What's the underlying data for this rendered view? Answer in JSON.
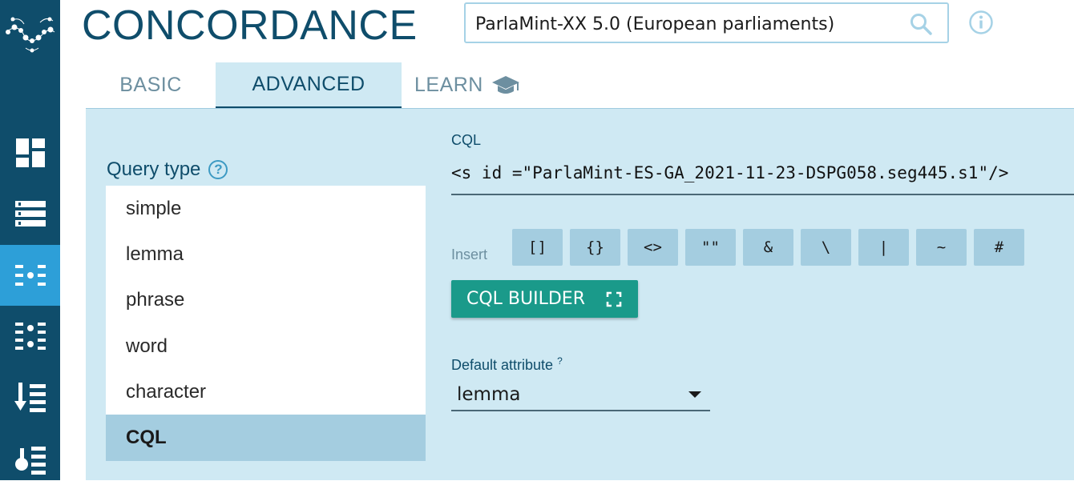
{
  "app": {
    "title": "CONCORDANCE"
  },
  "corpus": {
    "selected": "ParlaMint-XX 5.0 (European parliaments)"
  },
  "tabs": [
    {
      "label": "BASIC"
    },
    {
      "label": "ADVANCED"
    },
    {
      "label": "LEARN"
    }
  ],
  "query_type": {
    "label": "Query type",
    "help": "?",
    "options": [
      "simple",
      "lemma",
      "phrase",
      "word",
      "character",
      "CQL"
    ],
    "selected": "CQL"
  },
  "cql": {
    "label": "CQL",
    "value": "<s id =\"ParlaMint-ES-GA_2021-11-23-DSPG058.seg445.s1\"/>"
  },
  "insert": {
    "label": "Insert",
    "buttons": [
      "[]",
      "{}",
      "<>",
      "\"\"",
      "&",
      "\\",
      "|",
      "~",
      "#"
    ]
  },
  "cql_builder": {
    "label": "CQL BUILDER"
  },
  "default_attribute": {
    "label": "Default attribute",
    "help": "?",
    "value": "lemma"
  },
  "sidebar": {
    "icons": [
      "dashboard-icon",
      "list-icon",
      "concordance-icon",
      "parallel-concordance-icon",
      "sort-icon",
      "frequency-icon"
    ],
    "active": "concordance-icon"
  },
  "colors": {
    "sidebar": "#0f4d6b",
    "active_nav": "#2d9fd8",
    "panel": "#cfe9f3",
    "button": "#a4cde0",
    "builder": "#1a9a8a"
  }
}
